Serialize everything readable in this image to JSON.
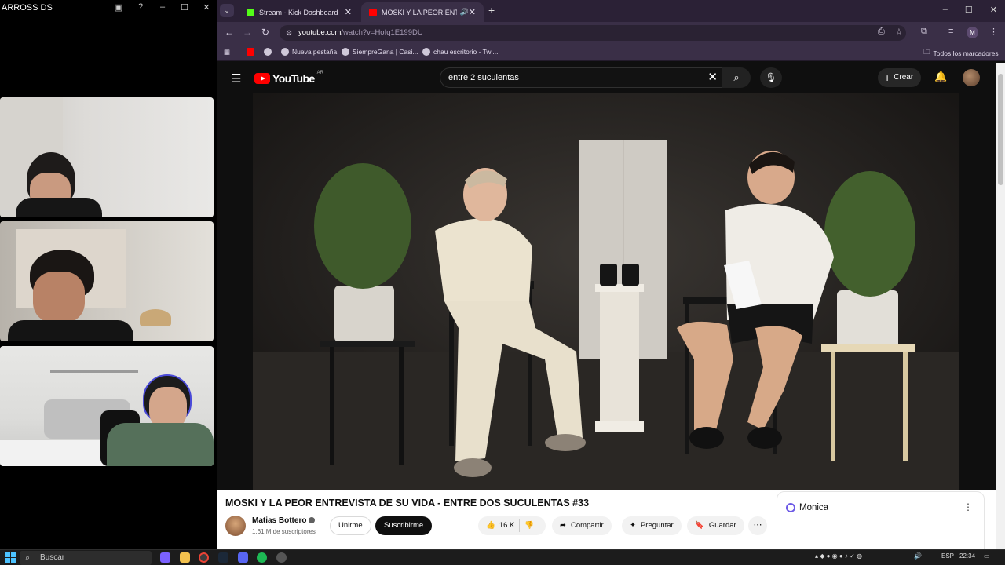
{
  "left_panel": {
    "title": "ARROSS DS"
  },
  "browser": {
    "tabs": [
      {
        "label": "Stream - Kick Dashboard",
        "favicon_color": "#53fc18"
      },
      {
        "label": "MOSKI Y LA PEOR ENTREVI",
        "favicon_color": "#ff0000"
      }
    ],
    "address": {
      "host": "youtube.com",
      "path": "/watch?v=HoIq1E199DU"
    },
    "profile_initial": "M",
    "bookmarks": [
      {
        "label": ""
      },
      {
        "label": ""
      },
      {
        "label": "Nueva pestaña"
      },
      {
        "label": "SiempreGana | Casi..."
      },
      {
        "label": "chau escritorio - Twi..."
      }
    ],
    "all_bookmarks": "Todos los marcadores"
  },
  "youtube": {
    "logo_text": "YouTube",
    "country_code": "AR",
    "search_query": "entre 2 suculentas",
    "create_label": "Crear",
    "video_title": "MOSKI Y LA PEOR ENTREVISTA DE SU VIDA - ENTRE DOS SUCULENTAS #33",
    "channel_name": "Matias Bottero",
    "subscribers": "1,61 M de suscriptores",
    "join_label": "Unirme",
    "subscribe_label": "Suscribirme",
    "likes": "16 K",
    "share_label": "Compartir",
    "ask_label": "Preguntar",
    "save_label": "Guardar",
    "side_panel_title": "Monica"
  },
  "taskbar": {
    "search_placeholder": "Buscar",
    "language": "ESP",
    "time": "22:34"
  },
  "colors": {
    "browser_tabbar": "#2b2136",
    "browser_toolbar": "#3a2f47",
    "youtube_red": "#ff0000",
    "youtube_bg": "#0f0f0f"
  }
}
